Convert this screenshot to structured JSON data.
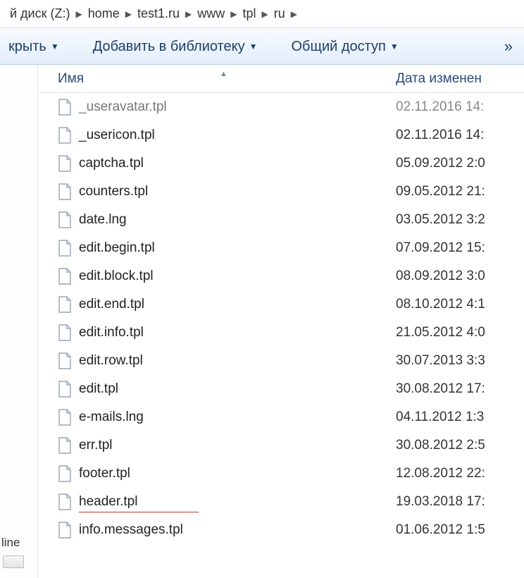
{
  "breadcrumb": {
    "prefix": "й диск (Z:)",
    "items": [
      "home",
      "test1.ru",
      "www",
      "tpl",
      "ru"
    ]
  },
  "toolbar": {
    "open_label": "крыть",
    "add_library_label": "Добавить в библиотеку",
    "share_label": "Общий доступ",
    "overflow_glyph": "»"
  },
  "columns": {
    "name": "Имя",
    "date": "Дата изменен"
  },
  "sidebar": {
    "label": "line"
  },
  "files": [
    {
      "name": "_useravatar.tpl",
      "date": "02.11.2016 14:",
      "faded": true
    },
    {
      "name": "_usericon.tpl",
      "date": "02.11.2016 14:"
    },
    {
      "name": "captcha.tpl",
      "date": "05.09.2012 2:0"
    },
    {
      "name": "counters.tpl",
      "date": "09.05.2012 21:"
    },
    {
      "name": "date.lng",
      "date": "03.05.2012 3:2"
    },
    {
      "name": "edit.begin.tpl",
      "date": "07.09.2012 15:"
    },
    {
      "name": "edit.block.tpl",
      "date": "08.09.2012 3:0"
    },
    {
      "name": "edit.end.tpl",
      "date": "08.10.2012 4:1"
    },
    {
      "name": "edit.info.tpl",
      "date": "21.05.2012 4:0"
    },
    {
      "name": "edit.row.tpl",
      "date": "30.07.2013 3:3"
    },
    {
      "name": "edit.tpl",
      "date": "30.08.2012 17:"
    },
    {
      "name": "e-mails.lng",
      "date": "04.11.2012 1:3"
    },
    {
      "name": "err.tpl",
      "date": "30.08.2012 2:5"
    },
    {
      "name": "footer.tpl",
      "date": "12.08.2012 22:"
    },
    {
      "name": "header.tpl",
      "date": "19.03.2018 17:",
      "underline": true
    },
    {
      "name": "info.messages.tpl",
      "date": "01.06.2012 1:5"
    }
  ]
}
